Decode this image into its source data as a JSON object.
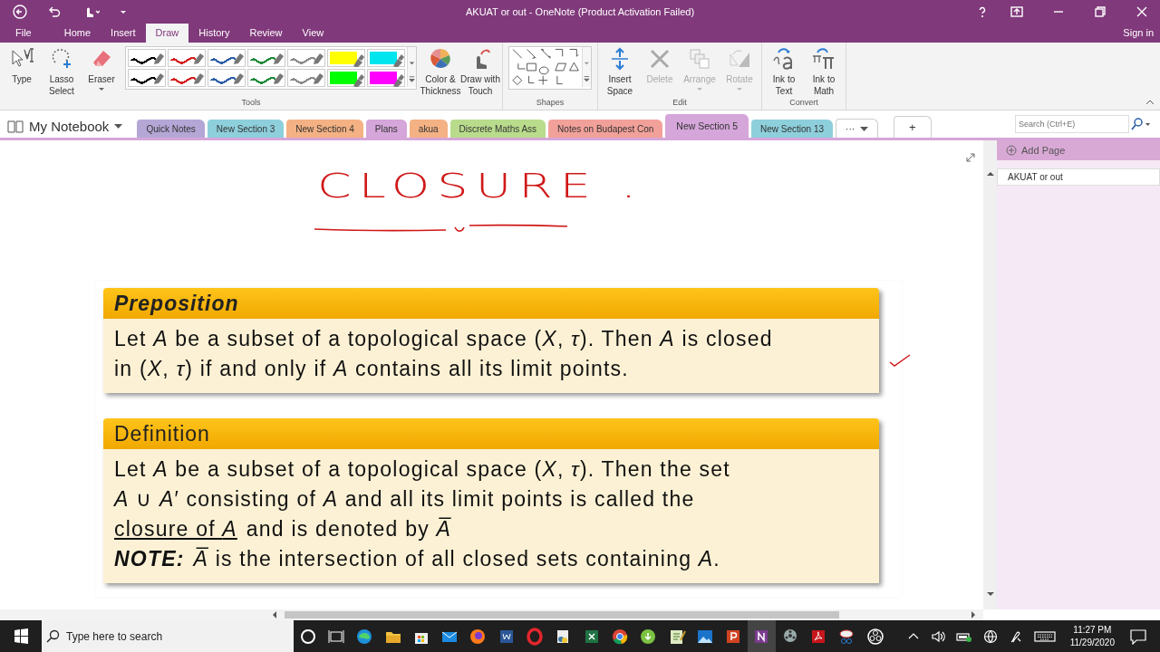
{
  "titlebar": {
    "title": "AKUAT or out - OneNote (Product Activation Failed)"
  },
  "menu_tabs": [
    {
      "label": "File",
      "selected": false
    },
    {
      "label": "Home",
      "selected": false
    },
    {
      "label": "Insert",
      "selected": false
    },
    {
      "label": "Draw",
      "selected": true
    },
    {
      "label": "History",
      "selected": false
    },
    {
      "label": "Review",
      "selected": false
    },
    {
      "label": "View",
      "selected": false
    }
  ],
  "account": {
    "label": "Sign in"
  },
  "ribbon": {
    "groups": [
      {
        "label": "Tools",
        "items": [
          {
            "kind": "button",
            "label": "Type",
            "disabled": false,
            "dropdown": false
          },
          {
            "kind": "button",
            "label": "Lasso Select",
            "disabled": false,
            "dropdown": false
          },
          {
            "kind": "button",
            "label": "Eraser",
            "disabled": false,
            "dropdown": true
          },
          {
            "kind": "pens",
            "pens": [
              {
                "color": "#000000",
                "kind": "pen",
                "selected": false
              },
              {
                "color": "#d42020",
                "kind": "pen",
                "selected": false
              },
              {
                "color": "#2e5fa8",
                "kind": "pen",
                "selected": false
              },
              {
                "color": "#1f8a3a",
                "kind": "pen",
                "selected": false
              },
              {
                "color": "#8a8a8a",
                "kind": "pen",
                "selected": false
              },
              {
                "color": "#ffff00",
                "kind": "highlighter",
                "selected": false
              },
              {
                "color": "#00e5ee",
                "kind": "highlighter",
                "selected": false
              },
              {
                "color": "#000000",
                "kind": "pen",
                "selected": false
              },
              {
                "color": "#d42020",
                "kind": "pen",
                "selected": false
              },
              {
                "color": "#2e5fa8",
                "kind": "pen",
                "selected": false
              },
              {
                "color": "#1f8a3a",
                "kind": "pen",
                "selected": false
              },
              {
                "color": "#8a8a8a",
                "kind": "pen",
                "selected": false
              },
              {
                "color": "#00ff00",
                "kind": "highlighter",
                "selected": false
              },
              {
                "color": "#ff00ff",
                "kind": "highlighter",
                "selected": false
              }
            ]
          },
          {
            "kind": "button",
            "label": "Color & Thickness",
            "disabled": false,
            "dropdown": false
          },
          {
            "kind": "button",
            "label": "Draw with Touch",
            "disabled": false,
            "dropdown": false
          }
        ]
      },
      {
        "label": "Shapes",
        "items": [
          {
            "kind": "shapes"
          }
        ]
      },
      {
        "label": "Edit",
        "items": [
          {
            "kind": "button",
            "label": "Insert Space",
            "disabled": false,
            "dropdown": false
          },
          {
            "kind": "button",
            "label": "Delete",
            "disabled": true,
            "dropdown": false
          },
          {
            "kind": "button",
            "label": "Arrange",
            "disabled": true,
            "dropdown": true
          },
          {
            "kind": "button",
            "label": "Rotate",
            "disabled": true,
            "dropdown": true
          }
        ]
      },
      {
        "label": "Convert",
        "items": [
          {
            "kind": "button",
            "label": "Ink to Text",
            "disabled": false,
            "dropdown": false
          },
          {
            "kind": "button",
            "label": "Ink to Math",
            "disabled": false,
            "dropdown": false
          }
        ]
      }
    ]
  },
  "notebook": {
    "name": "My Notebook",
    "sections": [
      {
        "label": "Quick Notes",
        "color": "#b4a7d6",
        "selected": false
      },
      {
        "label": "New Section 3",
        "color": "#8ecfdc",
        "selected": false
      },
      {
        "label": "New Section 4",
        "color": "#f4b183",
        "selected": false
      },
      {
        "label": "Plans",
        "color": "#d5a6d9",
        "selected": false
      },
      {
        "label": "akua",
        "color": "#f4b183",
        "selected": false
      },
      {
        "label": "Discrete Maths Ass",
        "color": "#b9dc8c",
        "selected": false
      },
      {
        "label": "Notes on Budapest Con",
        "color": "#f2a19a",
        "selected": false
      },
      {
        "label": "New Section 5",
        "color": "#d5a6d9",
        "selected": true
      },
      {
        "label": "New Section 13",
        "color": "#8ecfdc",
        "selected": false
      }
    ],
    "more": "···",
    "add": "+",
    "search": {
      "placeholder": "Search (Ctrl+E)"
    }
  },
  "page": {
    "ink_title": "CLOSURE .",
    "blocks": [
      {
        "kind": "proposition",
        "title": "Preposition",
        "lines": [
          [
            {
              "text": "Let *A* be a subset of a topological space (*X*, *τ*). Then *A* is closed",
              "underlined": false
            }
          ],
          [
            {
              "text": "in (*X*, *τ*) if and only if *A* contains all its limit points.",
              "underlined": false
            }
          ]
        ]
      },
      {
        "kind": "definition",
        "title": "Definition",
        "lines": [
          [
            {
              "text": "Let *A* be a subset of a topological space (*X*, *τ*). Then the set",
              "underlined": false
            }
          ],
          [
            {
              "text": "*A* ∪ *A*′ consisting of *A* and all its limit points is called the",
              "underlined": false
            }
          ],
          [
            {
              "text": "closure of *A*",
              "underlined": true
            },
            {
              "text": "and is denoted by *A̅*",
              "underlined": false
            }
          ]
        ],
        "note": {
          "label": "NOTE:",
          "text": "*A̅* is the intersection of all closed sets containing *A*."
        }
      }
    ]
  },
  "pages_pane": {
    "add_page": "Add Page",
    "pages": [
      {
        "title": "AKUAT or out",
        "selected": true
      }
    ]
  },
  "taskbar": {
    "search": {
      "placeholder": "Type here to search"
    },
    "apps": [
      {
        "kind": "cortana",
        "active": false
      },
      {
        "kind": "taskview",
        "active": false
      },
      {
        "kind": "edge",
        "active": false
      },
      {
        "kind": "folder",
        "active": false
      },
      {
        "kind": "store",
        "active": false
      },
      {
        "kind": "mail",
        "active": false
      },
      {
        "kind": "firefox",
        "active": false
      },
      {
        "kind": "word",
        "active": false
      },
      {
        "kind": "opera",
        "active": false
      },
      {
        "kind": "python",
        "active": false
      },
      {
        "kind": "excel",
        "active": false
      },
      {
        "kind": "chrome",
        "active": false
      },
      {
        "kind": "download",
        "active": false
      },
      {
        "kind": "notepad",
        "active": false
      },
      {
        "kind": "photos",
        "active": false
      },
      {
        "kind": "powerpoint",
        "active": false
      },
      {
        "kind": "onenote",
        "active": true
      },
      {
        "kind": "film",
        "active": false
      },
      {
        "kind": "pdf",
        "active": false
      },
      {
        "kind": "snip",
        "active": false
      },
      {
        "kind": "obs",
        "active": false
      }
    ],
    "time": "11:27 PM",
    "date": "11/29/2020"
  }
}
